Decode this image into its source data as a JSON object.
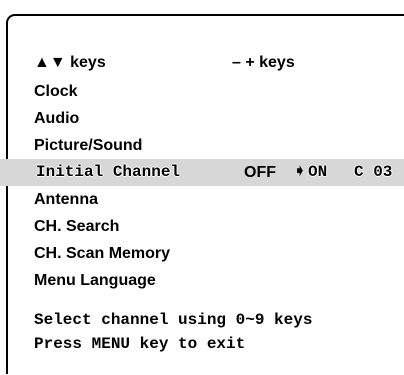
{
  "header": {
    "nav_keys": "▲▼ keys",
    "adjust_keys": "– + keys"
  },
  "menu": {
    "items": [
      {
        "label": "Clock"
      },
      {
        "label": "Audio"
      },
      {
        "label": "Picture/Sound"
      },
      {
        "label": "Initial Channel"
      },
      {
        "label": "Antenna"
      },
      {
        "label": "CH. Search"
      },
      {
        "label": "CH. Scan Memory"
      },
      {
        "label": "Menu Language"
      }
    ],
    "selected_index": 3,
    "selected_options": {
      "off": "OFF",
      "on_arrow": "➧",
      "on": "ON",
      "channel": "C 03"
    }
  },
  "help": {
    "line1": "Select channel using 0~9 keys",
    "line2": "Press MENU key to exit"
  }
}
